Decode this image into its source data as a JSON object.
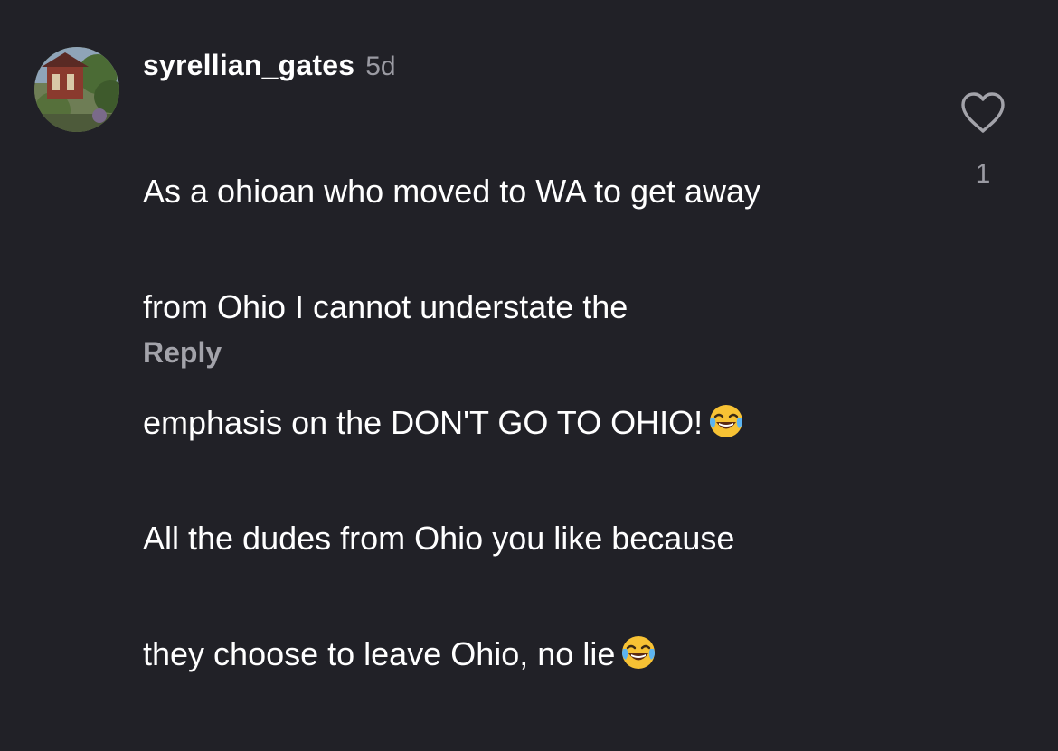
{
  "comment": {
    "username": "syrellian_gates",
    "time_ago": "5d",
    "lines": [
      "As a ohioan who moved to WA to get away",
      "from Ohio I cannot understate the",
      "emphasis on the DON'T GO TO OHIO!",
      "All the dudes from Ohio you like because",
      "they choose to leave Ohio, no lie"
    ],
    "reply_label": "Reply",
    "like_count": "1"
  },
  "icons": {
    "like": "heart-outline-icon",
    "emoji": "face-with-tears-of-joy-icon"
  },
  "colors": {
    "background": "#212127",
    "text": "#ffffff",
    "secondary": "#9b9ba3"
  }
}
